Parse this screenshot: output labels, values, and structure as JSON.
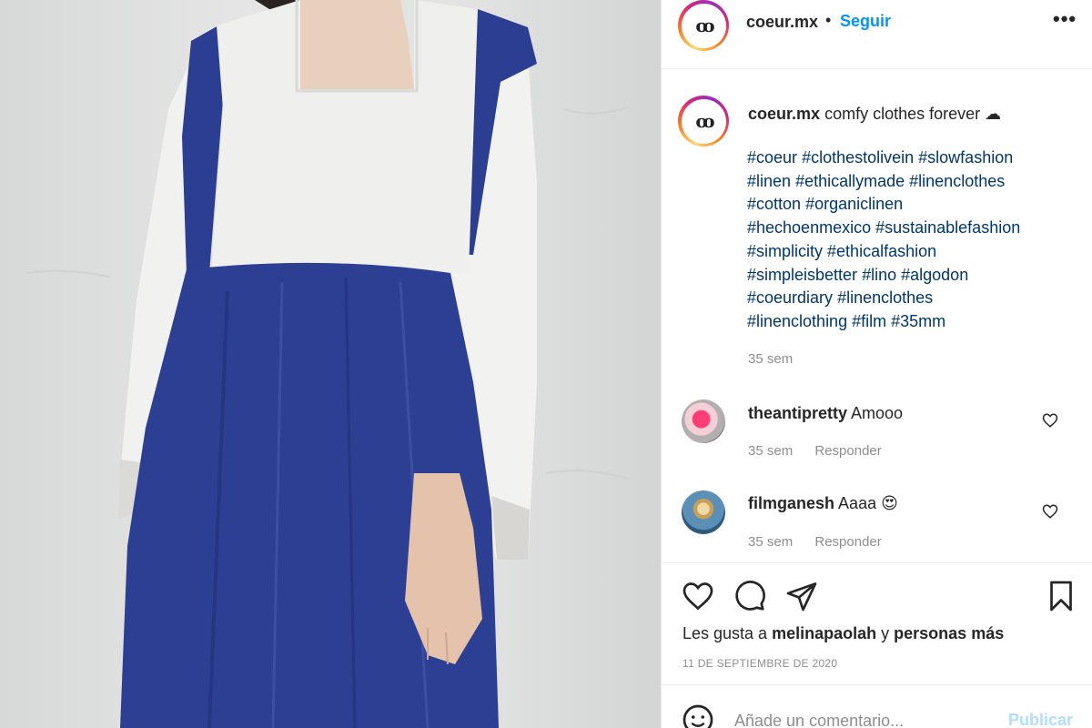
{
  "post": {
    "author": {
      "username": "coeur.mx",
      "follow_label": "Seguir",
      "separator": "•",
      "more_label": "•••"
    },
    "caption": {
      "username": "coeur.mx",
      "text": "comfy clothes forever ☁",
      "hashtags": [
        "#coeur",
        "#clothestolivein",
        "#slowfashion",
        "#linen",
        "#ethicallymade",
        "#linenclothes",
        "#cotton",
        "#organiclinen",
        "#hechoenmexico",
        "#sustainablefashion",
        "#simplicity",
        "#ethicalfashion",
        "#simpleisbetter",
        "#lino",
        "#algodon",
        "#coeurdiary",
        "#linenclothes",
        "#linenclothing",
        "#film",
        "#35mm"
      ],
      "time": "35 sem"
    },
    "comments": [
      {
        "username": "theantipretty",
        "text": "Amooo",
        "time": "35 sem",
        "reply_label": "Responder"
      },
      {
        "username": "filmganesh",
        "text": "Aaaa 😍",
        "time": "35 sem",
        "reply_label": "Responder"
      }
    ],
    "likes": {
      "prefix": "Les gusta a",
      "user": "melinapaolah",
      "connector": "y",
      "suffix": "personas más"
    },
    "date": "11 DE SEPTIEMBRE DE 2020",
    "comment_box": {
      "placeholder": "Añade un comentario...",
      "publish_label": "Publicar"
    }
  },
  "icons": {
    "more": "more-options-icon",
    "like": "heart-icon",
    "comment": "comment-icon",
    "share": "share-icon",
    "save": "bookmark-icon",
    "emoji": "emoji-icon"
  },
  "colors": {
    "link_blue": "#0095f6",
    "hashtag": "#00376b",
    "muted": "#8e8e8e",
    "publish_disabled": "#b2dffc",
    "dress_blue": "#2d3f92",
    "dress_white": "#eff0ee"
  }
}
